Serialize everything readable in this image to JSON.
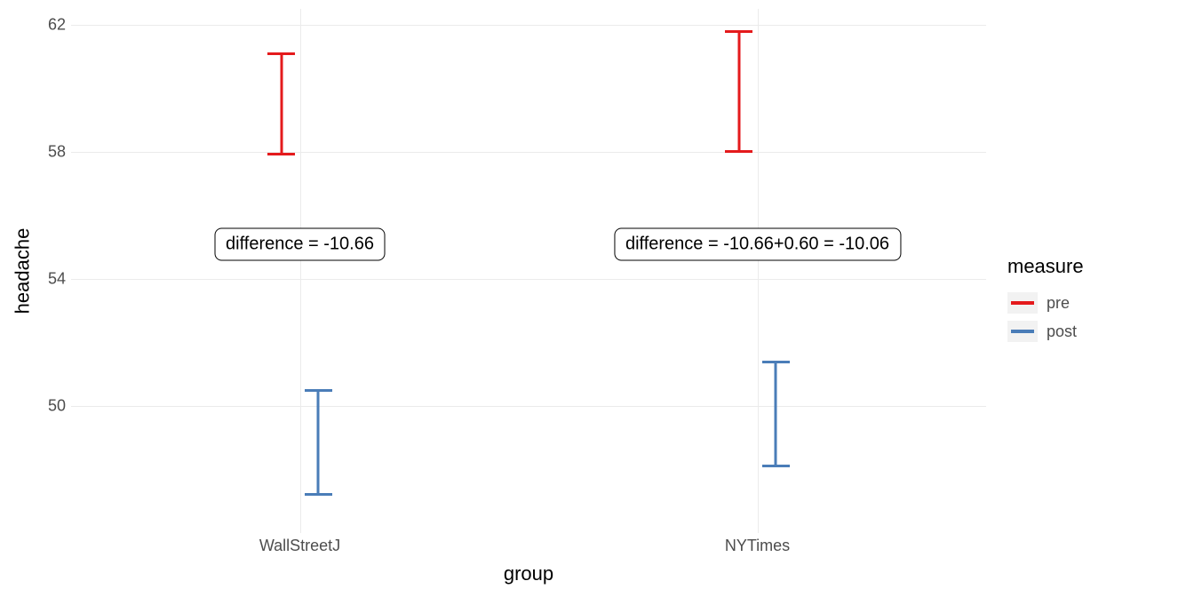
{
  "chart_data": {
    "type": "errorbar",
    "xlabel": "group",
    "ylabel": "headache",
    "ylim": [
      46,
      62.5
    ],
    "y_ticks": [
      50,
      54,
      58,
      62
    ],
    "categories": [
      "WallStreetJ",
      "NYTimes"
    ],
    "series": [
      {
        "name": "pre",
        "color": "#e41a1c",
        "points": [
          {
            "category": "WallStreetJ",
            "low": 57.9,
            "high": 61.1
          },
          {
            "category": "NYTimes",
            "low": 58.0,
            "high": 61.8
          }
        ]
      },
      {
        "name": "post",
        "color": "#4a7db8",
        "points": [
          {
            "category": "WallStreetJ",
            "low": 47.2,
            "high": 50.5
          },
          {
            "category": "NYTimes",
            "low": 48.1,
            "high": 51.4
          }
        ]
      }
    ],
    "legend_title": "measure",
    "annotations": [
      {
        "text": "difference = -10.66",
        "x_category": "WallStreetJ",
        "y": 55.1
      },
      {
        "text": "difference = -10.66+0.60 = -10.06",
        "x_category": "NYTimes",
        "y": 55.1
      }
    ]
  },
  "legend": {
    "title": "measure",
    "items": [
      {
        "label": "pre",
        "color": "#e41a1c"
      },
      {
        "label": "post",
        "color": "#4a7db8"
      }
    ]
  },
  "x_positions_pct": {
    "WallStreetJ": 25,
    "NYTimes": 75
  },
  "x_dodge_pct": {
    "pre": -2,
    "post": 2
  },
  "errorbar_width_pct": 3.0
}
